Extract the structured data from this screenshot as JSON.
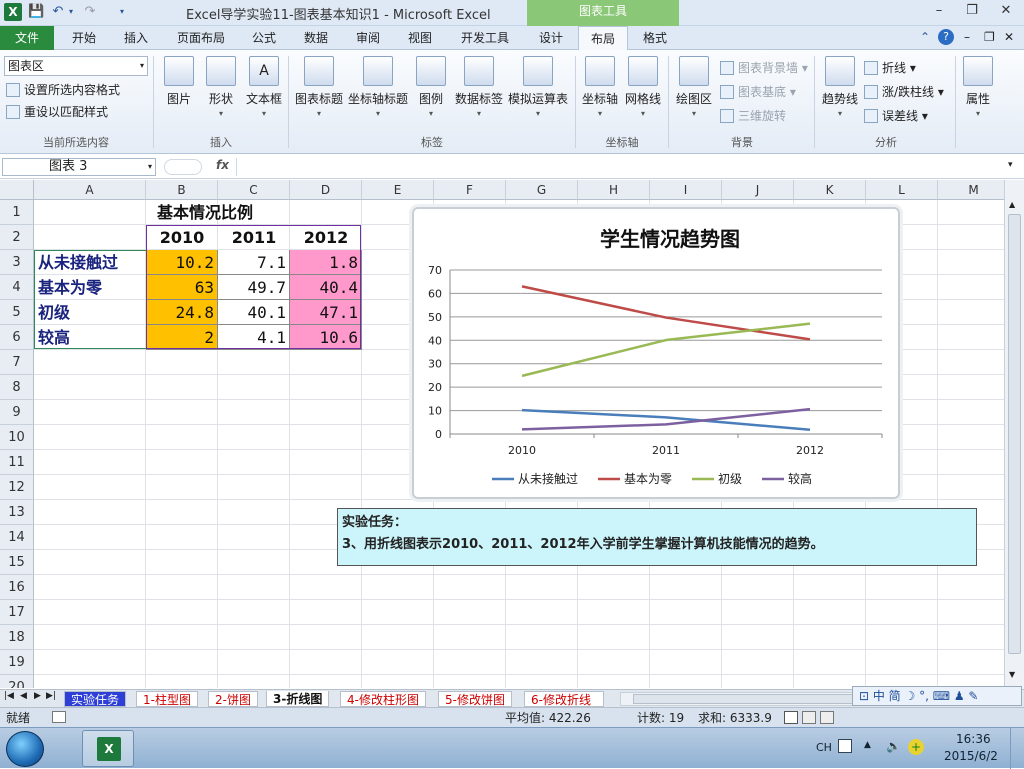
{
  "window": {
    "title": "Excel导学实验11-图表基本知识1  -  Microsoft Excel",
    "context_tools": "图表工具",
    "min": "–",
    "max": "❐",
    "close": "✕"
  },
  "tabs": [
    "文件",
    "开始",
    "插入",
    "页面布局",
    "公式",
    "数据",
    "审阅",
    "视图",
    "开发工具",
    "设计",
    "布局",
    "格式"
  ],
  "ribbon": {
    "current_selection": {
      "dropdown": "图表区",
      "format_selection": "设置所选内容格式",
      "reset_style": "重设以匹配样式",
      "group": "当前所选内容"
    },
    "insert": {
      "picture": "图片",
      "shapes": "形状",
      "textbox": "文本框",
      "group": "插入"
    },
    "labels": {
      "chart_title": "图表标题",
      "axis_titles": "坐标轴标题",
      "legend": "图例",
      "data_labels": "数据标签",
      "data_table": "模拟运算表",
      "group": "标签"
    },
    "axes": {
      "axes": "坐标轴",
      "gridlines": "网格线",
      "group": "坐标轴"
    },
    "background": {
      "plot_area": "绘图区",
      "chart_wall": "图表背景墙",
      "chart_floor": "图表基底",
      "rotation_3d": "三维旋转",
      "group": "背景"
    },
    "analysis": {
      "trendline": "趋势线",
      "lines": "折线",
      "updown_bars": "涨/跌柱线",
      "error_bars": "误差线",
      "group": "分析"
    },
    "properties": {
      "label": "属性"
    }
  },
  "formula_bar": {
    "name_box": "图表 3",
    "fx": "fx",
    "value": ""
  },
  "grid": {
    "columns": [
      "A",
      "B",
      "C",
      "D",
      "E",
      "F",
      "G",
      "H",
      "I",
      "J",
      "K",
      "L",
      "M"
    ],
    "rows": [
      "1",
      "2",
      "3",
      "4",
      "5",
      "6",
      "7",
      "8",
      "9",
      "10",
      "11",
      "12",
      "13",
      "14",
      "15",
      "16",
      "17",
      "18",
      "19",
      "20"
    ],
    "table_title": "基本情况比例",
    "years": [
      "2010",
      "2011",
      "2012"
    ],
    "row_labels": [
      "从未接触过",
      "基本为零",
      "初级",
      "较高"
    ],
    "values": [
      [
        "10.2",
        "7.1",
        "1.8"
      ],
      [
        "63",
        "49.7",
        "40.4"
      ],
      [
        "24.8",
        "40.1",
        "47.1"
      ],
      [
        "2",
        "4.1",
        "10.6"
      ]
    ]
  },
  "chart_data": {
    "type": "line",
    "title": "学生情况趋势图",
    "categories": [
      "2010",
      "2011",
      "2012"
    ],
    "ylim": [
      0,
      70
    ],
    "yticks": [
      "0",
      "10",
      "20",
      "30",
      "40",
      "50",
      "60",
      "70"
    ],
    "grid": true,
    "legend_position": "bottom",
    "series": [
      {
        "name": "从未接触过",
        "values": [
          10.2,
          7.1,
          1.8
        ],
        "color": "#4a7ebb"
      },
      {
        "name": "基本为零",
        "values": [
          63,
          49.7,
          40.4
        ],
        "color": "#be4b48"
      },
      {
        "name": "初级",
        "values": [
          24.8,
          40.1,
          47.1
        ],
        "color": "#98b954"
      },
      {
        "name": "较高",
        "values": [
          2,
          4.1,
          10.6
        ],
        "color": "#7d60a0"
      }
    ]
  },
  "note": {
    "line1": "实验任务：",
    "line2": "3、用折线图表示2010、2011、2012年入学前学生掌握计算机技能情况的趋势。"
  },
  "sheets": [
    "实验任务",
    "1-柱型图",
    "2-饼图",
    "3-折线图",
    "4-修改柱形图",
    "5-修改饼图",
    "6-修改折线"
  ],
  "status": {
    "ready": "就绪",
    "average": "平均值: 422.26",
    "count": "计数: 19",
    "sum": "求和: 6333.9"
  },
  "taskbar": {
    "time": "16:36",
    "date": "2015/6/2",
    "lang": "CH"
  }
}
